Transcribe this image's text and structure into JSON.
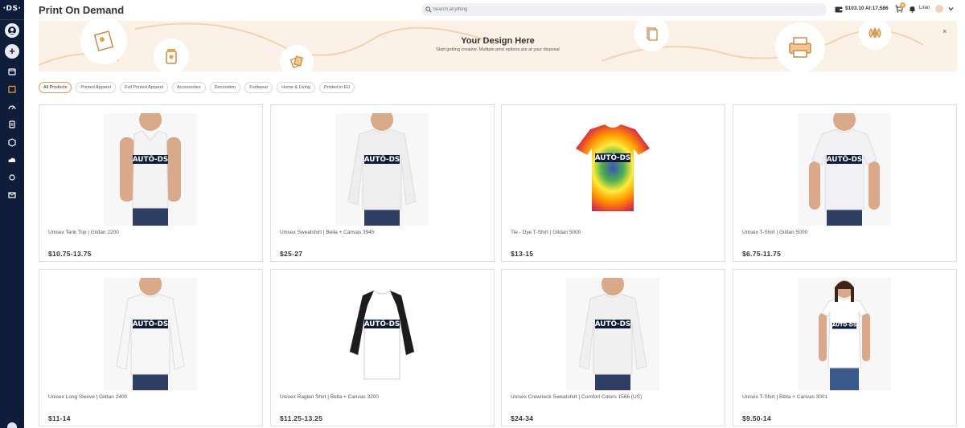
{
  "app": {
    "logo": "·DS·",
    "title": "Print On Demand"
  },
  "search": {
    "placeholder": "Search anything"
  },
  "header": {
    "balance": "$103.10  AI:17,586",
    "cart_count": "0",
    "username": "Liran"
  },
  "banner": {
    "title": "Your Design Here",
    "subtitle": "Start getting creative. Multiple print options are at your disposal",
    "close": "×"
  },
  "filters": [
    "All Products",
    "Printed Apparel",
    "Full Printed Apparel",
    "Accessories",
    "Decoration",
    "Footwear",
    "Home & Living",
    "Printed in EU"
  ],
  "products": [
    {
      "name": "Unisex Tank Top | Gildan 2200",
      "price": "$10.75-13.75",
      "print": "AUTŌ-DS",
      "garment": "tank",
      "shirt_color": "#f4f4f4",
      "sleeve_color": "#f4f4f4"
    },
    {
      "name": "Unisex Sweatshirt | Bella + Canvas 3945",
      "price": "$25-27",
      "print": "AUTŌ-DS",
      "garment": "sweatshirt",
      "shirt_color": "#eeeeee",
      "sleeve_color": "#eeeeee"
    },
    {
      "name": "Tie - Dye T-Shirt | Gildan 5000",
      "price": "$13-15",
      "print": "AUTŌ-DS",
      "garment": "tiedye",
      "shirt_color": "#e53935",
      "sleeve_color": "#e53935"
    },
    {
      "name": "Unisex T-Shirt | Gildan 5000",
      "price": "$6.75-11.75",
      "print": "AUTŌ-DS",
      "garment": "tee",
      "shirt_color": "#f2f2f4",
      "sleeve_color": "#f2f2f4"
    },
    {
      "name": "Unisex Long Sleeve | Gildan 2400",
      "price": "$11-14",
      "print": "AUTŌ-DS",
      "garment": "longsleeve",
      "shirt_color": "#f6f6f6",
      "sleeve_color": "#f6f6f6"
    },
    {
      "name": "Unisex Raglan Shirt | Bella + Canvas 3200",
      "price": "$11.25-13.25",
      "print": "AUTŌ-DS",
      "garment": "raglan",
      "shirt_color": "#ffffff",
      "sleeve_color": "#1c1c1c"
    },
    {
      "name": "Unisex Crewneck Sweatshirt | Comfort Colors 1566 (US)",
      "price": "$24-34",
      "print": "AUTŌ-DS",
      "garment": "sweatshirt",
      "shirt_color": "#f0f0f0",
      "sleeve_color": "#f0f0f0"
    },
    {
      "name": "Unisex T-Shirt | Bella + Canvas 3001",
      "price": "$9.50-14",
      "print": "AUTŌ-DS",
      "garment": "womentee",
      "shirt_color": "#ffffff",
      "sleeve_color": "#ffffff"
    }
  ]
}
